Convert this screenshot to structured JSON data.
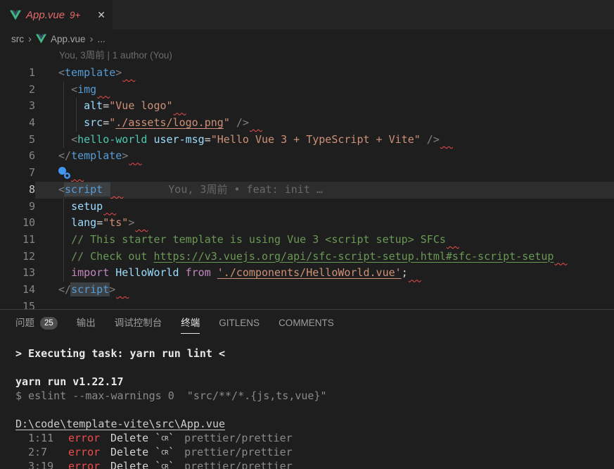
{
  "colors": {
    "editor_bg": "#1e1e1e",
    "tabstrip_bg": "#252526",
    "error_red": "#f14c4c",
    "tab_title_error": "#e5696d",
    "vue_green": "#41b883",
    "vue_dark": "#35495e",
    "string_orange": "#ce9178",
    "tag_blue": "#569cd6",
    "comment_green": "#6a9955",
    "keyword_magenta": "#c586c0",
    "component_teal": "#4ec9b0",
    "attr_blue": "#9cdcfe",
    "gutter_icon_blue": "#4096f0"
  },
  "tab": {
    "file": "App.vue",
    "problems": "9+",
    "close_glyph": "✕"
  },
  "breadcrumb": {
    "separator": "›",
    "items": [
      {
        "label": "src",
        "icon": null
      },
      {
        "label": "App.vue",
        "icon": "vue"
      },
      {
        "label": "...",
        "icon": null
      }
    ]
  },
  "editor": {
    "blame_header": "You, 3周前 | 1 author (You)",
    "inline_blame": "You, 3周前 • feat: init …",
    "lines": [
      {
        "num": "1",
        "guides": 0,
        "sq": true,
        "tokens": [
          [
            "<",
            "p"
          ],
          [
            "template",
            "tag"
          ],
          [
            ">",
            "p"
          ]
        ]
      },
      {
        "num": "2",
        "guides": 1,
        "sq": true,
        "tokens": [
          [
            "  ",
            ""
          ],
          [
            "<",
            "p"
          ],
          [
            "img",
            "tag"
          ]
        ]
      },
      {
        "num": "3",
        "guides": 2,
        "sq": true,
        "tokens": [
          [
            "    ",
            ""
          ],
          [
            "alt",
            "attr"
          ],
          [
            "=",
            "op"
          ],
          [
            "\"Vue logo\"",
            "str"
          ]
        ]
      },
      {
        "num": "4",
        "guides": 2,
        "sq": true,
        "tokens": [
          [
            "    ",
            ""
          ],
          [
            "src",
            "attr"
          ],
          [
            "=",
            "op"
          ],
          [
            "\"",
            "str"
          ],
          [
            "./assets/logo.png",
            "str lnk"
          ],
          [
            "\"",
            "str"
          ],
          [
            " ",
            ""
          ],
          [
            "/>",
            "p"
          ]
        ]
      },
      {
        "num": "5",
        "guides": 1,
        "sq": true,
        "tokens": [
          [
            "  ",
            ""
          ],
          [
            "<",
            "p"
          ],
          [
            "hello-world",
            "comp"
          ],
          [
            " ",
            ""
          ],
          [
            "user-msg",
            "attr"
          ],
          [
            "=",
            "op"
          ],
          [
            "\"Hello Vue 3 + TypeScript + Vite\"",
            "str"
          ],
          [
            " ",
            ""
          ],
          [
            "/>",
            "p"
          ]
        ]
      },
      {
        "num": "6",
        "guides": 0,
        "sq": true,
        "tokens": [
          [
            "</",
            "p"
          ],
          [
            "template",
            "tag"
          ],
          [
            ">",
            "p"
          ]
        ]
      },
      {
        "num": "7",
        "guides": 0,
        "sq": true,
        "icon": true,
        "tokens": []
      },
      {
        "num": "8",
        "guides": 0,
        "sq": true,
        "current": true,
        "blame": true,
        "tokens": [
          [
            "<",
            "p"
          ],
          [
            "script",
            "tag box sel"
          ]
        ]
      },
      {
        "num": "9",
        "guides": 1,
        "sq": true,
        "tokens": [
          [
            "  ",
            ""
          ],
          [
            "setup",
            "attr"
          ]
        ]
      },
      {
        "num": "10",
        "guides": 1,
        "sq": true,
        "tokens": [
          [
            "  ",
            ""
          ],
          [
            "lang",
            "attr"
          ],
          [
            "=",
            "op"
          ],
          [
            "\"ts\"",
            "str"
          ],
          [
            ">",
            "p"
          ]
        ]
      },
      {
        "num": "11",
        "guides": 1,
        "sq": true,
        "tokens": [
          [
            "  ",
            ""
          ],
          [
            "// This starter template is using Vue 3 <script setup> SFCs",
            "com"
          ]
        ]
      },
      {
        "num": "12",
        "guides": 1,
        "sq": true,
        "tokens": [
          [
            "  ",
            ""
          ],
          [
            "// Check out ",
            "com"
          ],
          [
            "https://v3.vuejs.org/api/sfc-script-setup.html#sfc-script-setup",
            "com lnk"
          ]
        ]
      },
      {
        "num": "13",
        "guides": 1,
        "sq": true,
        "tokens": [
          [
            "  ",
            ""
          ],
          [
            "import",
            "kw"
          ],
          [
            " ",
            ""
          ],
          [
            "HelloWorld",
            "id"
          ],
          [
            " ",
            ""
          ],
          [
            "from",
            "kw"
          ],
          [
            " ",
            ""
          ],
          [
            "'./components/HelloWorld.vue'",
            "str lnk"
          ],
          [
            ";",
            "op"
          ]
        ]
      },
      {
        "num": "14",
        "guides": 0,
        "sq": true,
        "tokens": [
          [
            "</",
            "p"
          ],
          [
            "script",
            "tag box"
          ],
          [
            ">",
            "p"
          ]
        ]
      },
      {
        "num": "15",
        "guides": 0,
        "sq": false,
        "tokens": []
      }
    ]
  },
  "panel": {
    "tabs": [
      {
        "name": "problems",
        "label": "问题",
        "badge": "25"
      },
      {
        "name": "output",
        "label": "输出"
      },
      {
        "name": "debug-console",
        "label": "调试控制台"
      },
      {
        "name": "terminal",
        "label": "终端",
        "active": true
      },
      {
        "name": "gitlens",
        "label": "GITLENS"
      },
      {
        "name": "comments",
        "label": "COMMENTS"
      }
    ]
  },
  "terminal": {
    "lines": [
      {
        "kind": "task",
        "text": "> Executing task: yarn run lint <"
      },
      {
        "kind": "blank"
      },
      {
        "kind": "strong",
        "text": "yarn run v1.22.17"
      },
      {
        "kind": "dim",
        "text": "$ eslint --max-warnings 0  \"src/**/*.{js,ts,vue}\""
      },
      {
        "kind": "blank"
      },
      {
        "kind": "path",
        "text": "D:\\code\\template-vite\\src\\App.vue"
      },
      {
        "kind": "error",
        "loc": "1:11",
        "severity": "error",
        "message_prefix": "Delete `",
        "cr_symbol": "CR",
        "message_suffix": "`",
        "rule": "prettier/prettier"
      },
      {
        "kind": "error",
        "loc": "2:7",
        "severity": "error",
        "message_prefix": "Delete `",
        "cr_symbol": "CR",
        "message_suffix": "`",
        "rule": "prettier/prettier"
      },
      {
        "kind": "error",
        "loc": "3:19",
        "severity": "error",
        "message_prefix": "Delete `",
        "cr_symbol": "CR",
        "message_suffix": "`",
        "rule": "prettier/prettier"
      }
    ]
  }
}
